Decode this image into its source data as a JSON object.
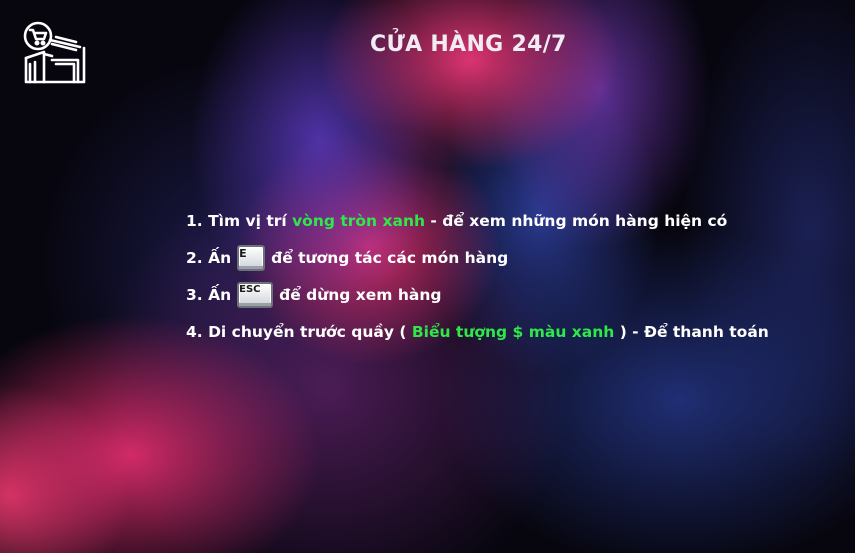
{
  "title": "CỬA HÀNG 24/7",
  "icons": {
    "shop": "shop-storefront-icon"
  },
  "instructions": [
    {
      "prefix": "1. Tìm vị trí ",
      "highlight": "vòng tròn xanh",
      "suffix": " - để xem những món hàng hiện có"
    },
    {
      "prefix": "2. Ấn",
      "key": "E",
      "suffix": "để tương tác các món hàng"
    },
    {
      "prefix": "3. Ấn",
      "key": "ESC",
      "suffix": "để dừng xem hàng"
    },
    {
      "prefix": "4. Di chuyển trước quầy ( ",
      "highlight": "Biểu tượng $ màu xanh",
      "suffix": " ) - Để thanh toán"
    }
  ],
  "colors": {
    "highlight": "#2ee84a",
    "title": "#f1ecf4",
    "text": "#ffffff"
  }
}
